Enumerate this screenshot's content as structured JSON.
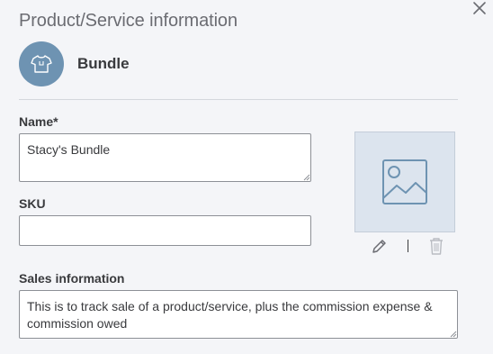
{
  "panel": {
    "title": "Product/Service information",
    "close_icon": "close-icon"
  },
  "item_type": {
    "icon": "shirt-icon",
    "label": "Bundle",
    "avatar_color": "#6e93b2"
  },
  "fields": {
    "name": {
      "label": "Name*",
      "value": "Stacy's Bundle"
    },
    "sku": {
      "label": "SKU",
      "value": ""
    },
    "sales_info": {
      "label": "Sales information",
      "value": "This is to track sale of a product/service, plus the commission expense & commission owed"
    }
  },
  "image": {
    "placeholder_icon": "image-placeholder-icon",
    "edit_icon": "pencil-icon",
    "delete_icon": "trash-icon"
  }
}
